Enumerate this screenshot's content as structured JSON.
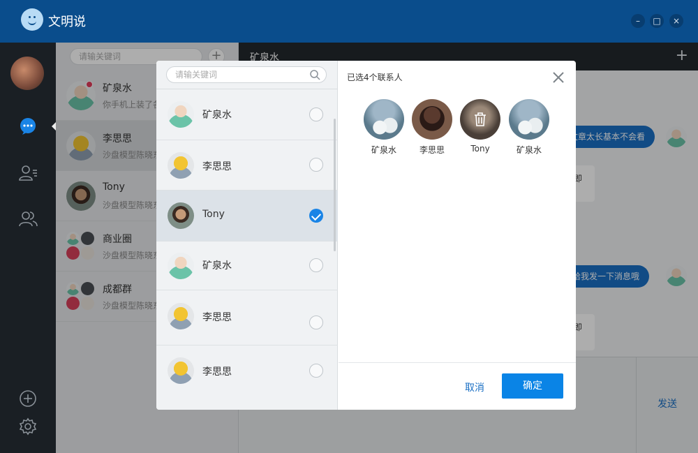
{
  "app": {
    "title": "文明说"
  },
  "window_controls": {
    "minimize": "–",
    "maximize": "□",
    "close": "×"
  },
  "conversation_list": {
    "search_placeholder": "请输关键词",
    "add_label": "+",
    "items": [
      {
        "name": "矿泉水",
        "message": "你手机上装了各",
        "avatar": "kqs",
        "unread": true
      },
      {
        "name": "李思思",
        "message": "沙盘模型陈晓东",
        "avatar": "lss",
        "active": true
      },
      {
        "name": "Tony",
        "message": "沙盘模型陈晓东",
        "avatar": "tony"
      },
      {
        "name": "商业圈",
        "message": "沙盘模型陈晓东",
        "avatar": "group"
      },
      {
        "name": "成都群",
        "message": "沙盘模型陈晓东",
        "avatar": "group"
      }
    ]
  },
  "chat": {
    "title": "矿泉水",
    "add_label": "+",
    "messages": [
      {
        "side": "out",
        "text": "文章太长基本不会看"
      },
      {
        "side": "in",
        "text": "即"
      },
      {
        "side": "out",
        "text": "给我发一下消息哦"
      },
      {
        "side": "in",
        "text": "即"
      }
    ],
    "send_label": "发送"
  },
  "modal": {
    "search_placeholder": "请输关键词",
    "contacts": [
      {
        "name": "矿泉水",
        "avatar": "kqs",
        "selected": false
      },
      {
        "name": "李思思",
        "avatar": "lss",
        "selected": false
      },
      {
        "name": "Tony",
        "avatar": "tony",
        "selected": true
      },
      {
        "name": "矿泉水",
        "avatar": "kqs",
        "selected": false
      },
      {
        "name": "李思思",
        "avatar": "lss",
        "selected": false
      },
      {
        "name": "李思思",
        "avatar": "lss",
        "selected": false
      }
    ],
    "selected_title": "已选4个联系人",
    "selected": [
      {
        "name": "矿泉水",
        "avatar": "flower"
      },
      {
        "name": "李思思",
        "avatar": "woman"
      },
      {
        "name": "Tony",
        "avatar": "dim",
        "hover_delete": true
      },
      {
        "name": "矿泉水",
        "avatar": "flower"
      }
    ],
    "cancel_label": "取消",
    "confirm_label": "确定"
  }
}
